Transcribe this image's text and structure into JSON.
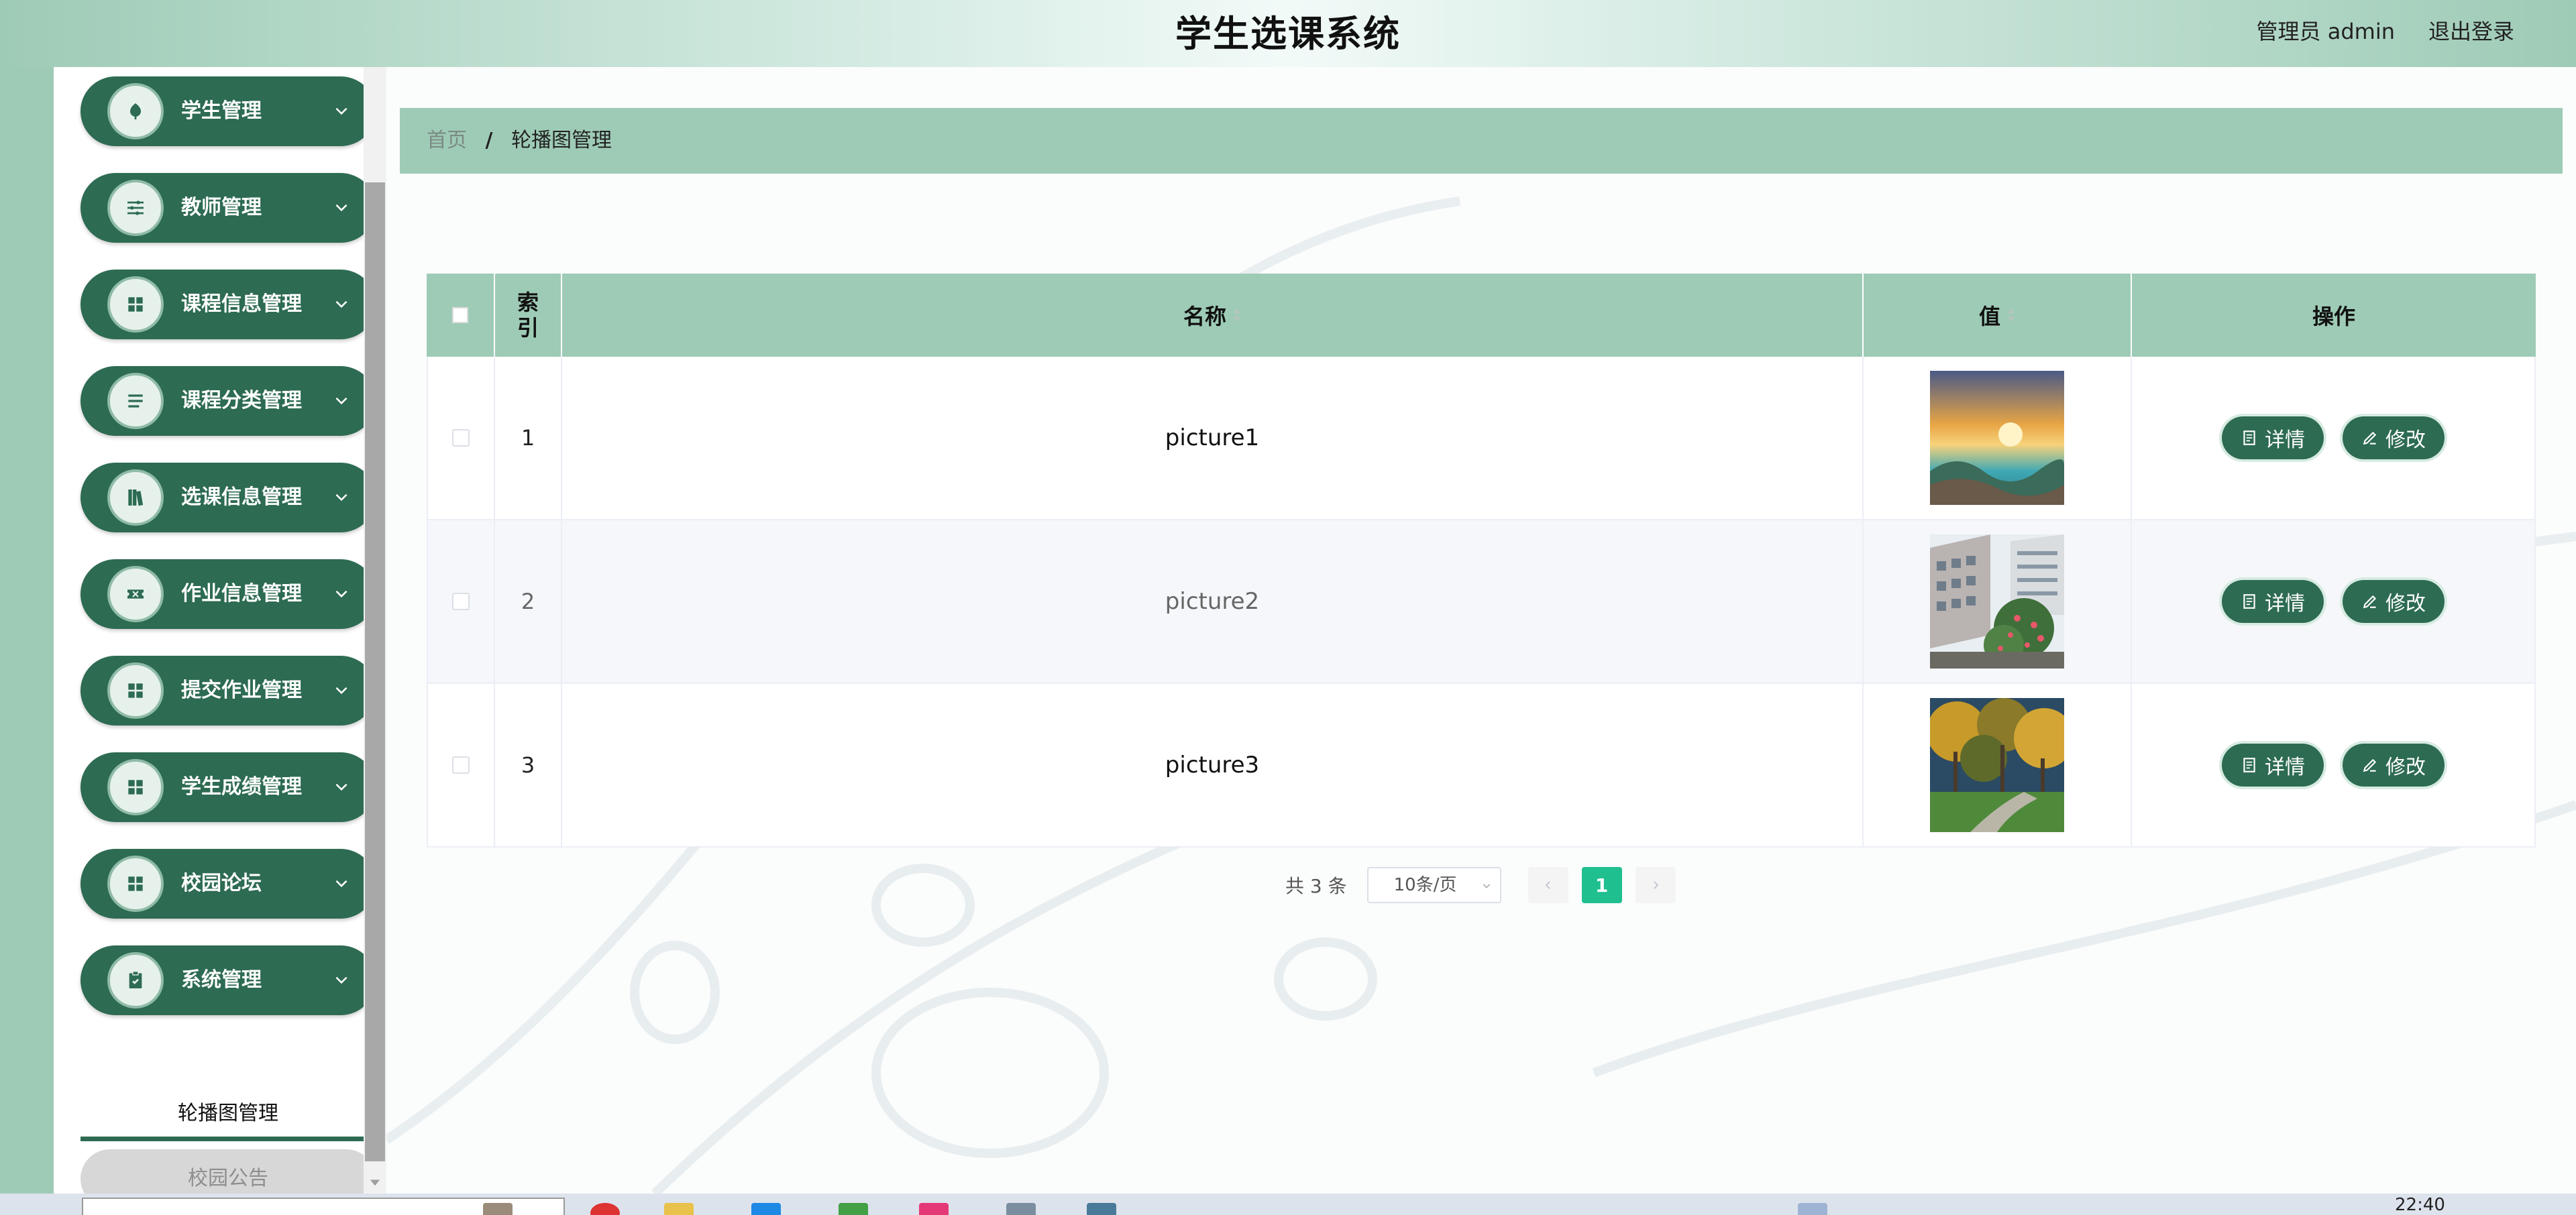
{
  "app": {
    "title": "学生选课系统",
    "user_label": "管理员 admin",
    "logout_label": "退出登录"
  },
  "sidebar": {
    "items": [
      {
        "label": "学生管理",
        "icon": "leaf-icon"
      },
      {
        "label": "教师管理",
        "icon": "sliders-icon"
      },
      {
        "label": "课程信息管理",
        "icon": "grid-icon"
      },
      {
        "label": "课程分类管理",
        "icon": "list-icon"
      },
      {
        "label": "选课信息管理",
        "icon": "book-icon"
      },
      {
        "label": "作业信息管理",
        "icon": "ticket-icon"
      },
      {
        "label": "提交作业管理",
        "icon": "grid-icon"
      },
      {
        "label": "学生成绩管理",
        "icon": "grid-icon"
      },
      {
        "label": "校园论坛",
        "icon": "grid-icon"
      },
      {
        "label": "系统管理",
        "icon": "clipboard-icon"
      }
    ],
    "sub_items": [
      {
        "label": "轮播图管理",
        "active": true
      },
      {
        "label": "校园公告",
        "active": false
      }
    ]
  },
  "breadcrumb": {
    "home": "首页",
    "separator": "/",
    "current": "轮播图管理"
  },
  "table": {
    "headers": {
      "index_line1": "索",
      "index_line2": "引",
      "name": "名称",
      "value": "值",
      "actions": "操作"
    },
    "rows": [
      {
        "index": "1",
        "name": "picture1",
        "image": "sunset-sea-image"
      },
      {
        "index": "2",
        "name": "picture2",
        "image": "campus-building-image"
      },
      {
        "index": "3",
        "name": "picture3",
        "image": "autumn-trees-image"
      }
    ],
    "detail_label": "详情",
    "edit_label": "修改"
  },
  "pagination": {
    "total": "共 3 条",
    "page_size": "10条/页",
    "current_page": "1"
  },
  "taskbar": {
    "clock": "22:40"
  },
  "colors": {
    "primary": "#2d6b52",
    "header_green": "#9ecbb6",
    "active_page": "#1fbf8f"
  }
}
